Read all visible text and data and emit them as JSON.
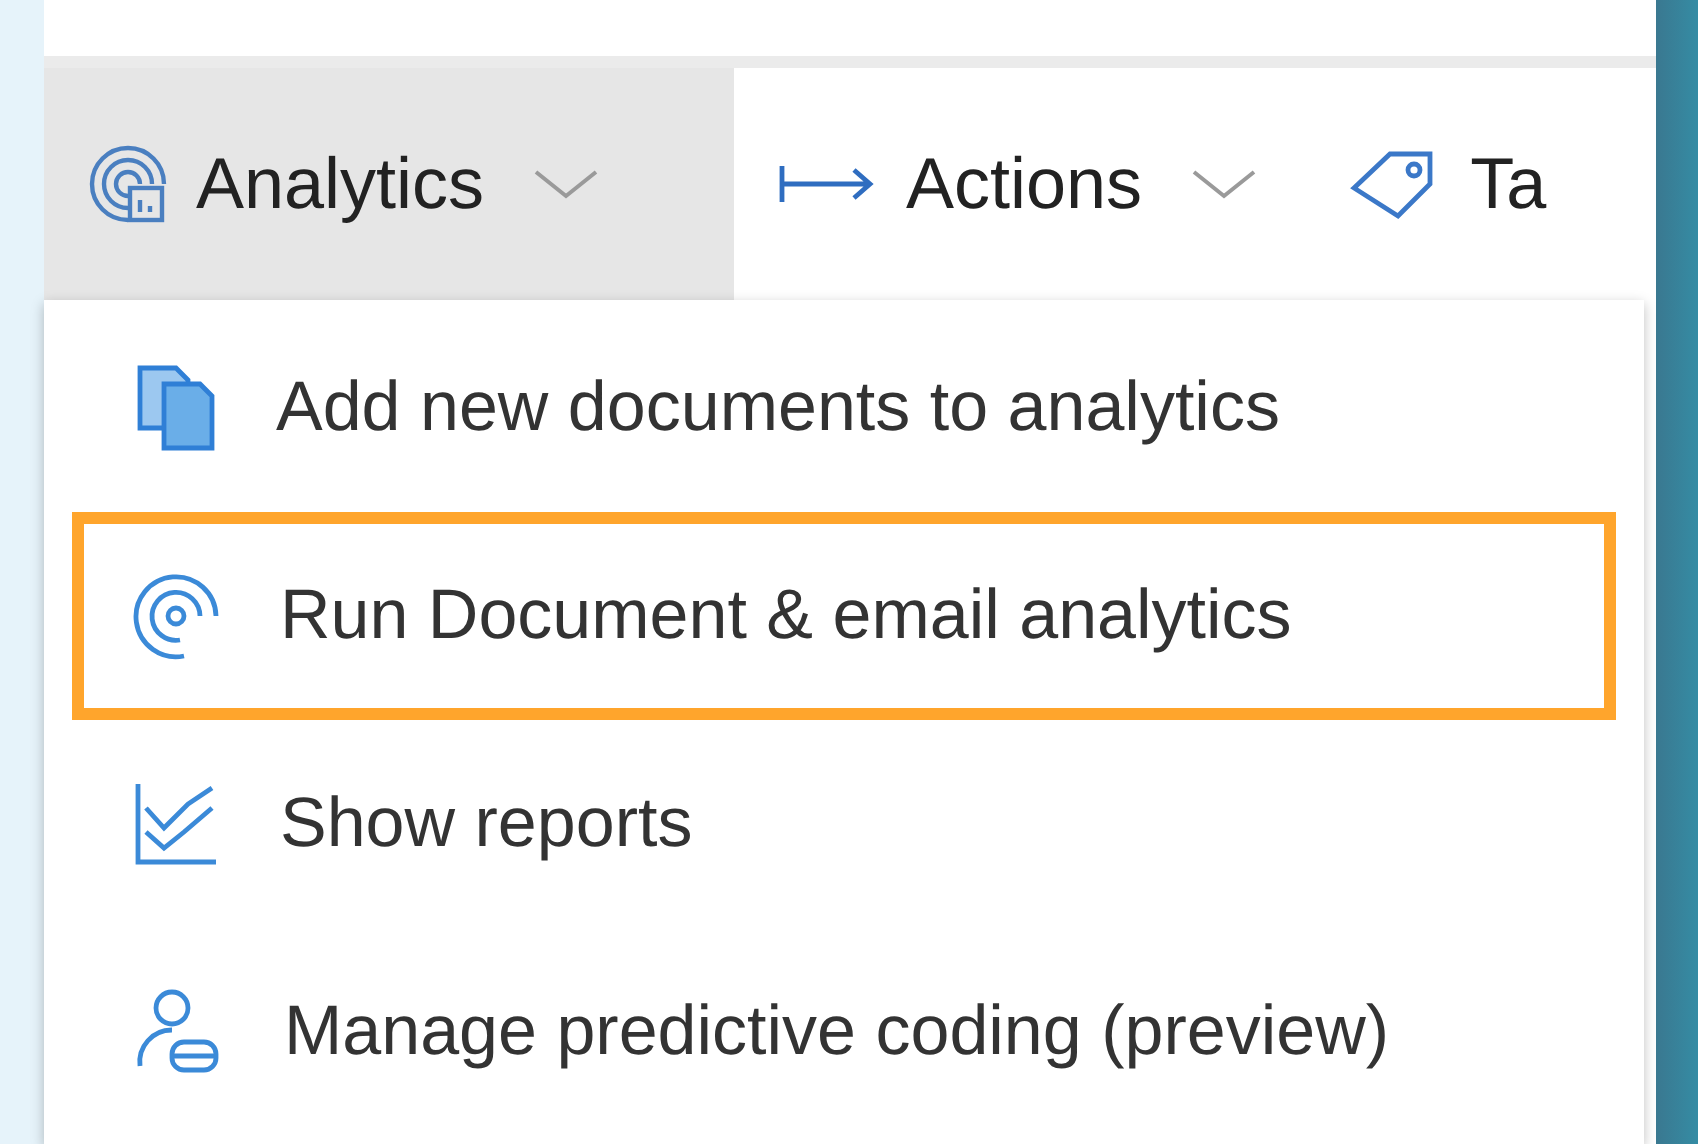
{
  "toolbar": {
    "items": [
      {
        "label": "Analytics",
        "kind": "dropdown",
        "selected": true
      },
      {
        "label": "Actions",
        "kind": "dropdown",
        "selected": false
      },
      {
        "label": "Ta",
        "kind": "plain",
        "selected": false
      }
    ]
  },
  "menu": {
    "items": [
      {
        "label": "Add new documents to analytics",
        "highlighted": false
      },
      {
        "label": "Run Document & email analytics",
        "highlighted": true
      },
      {
        "label": "Show reports",
        "highlighted": false
      },
      {
        "label": "Manage predictive coding (preview)",
        "highlighted": false
      }
    ]
  }
}
